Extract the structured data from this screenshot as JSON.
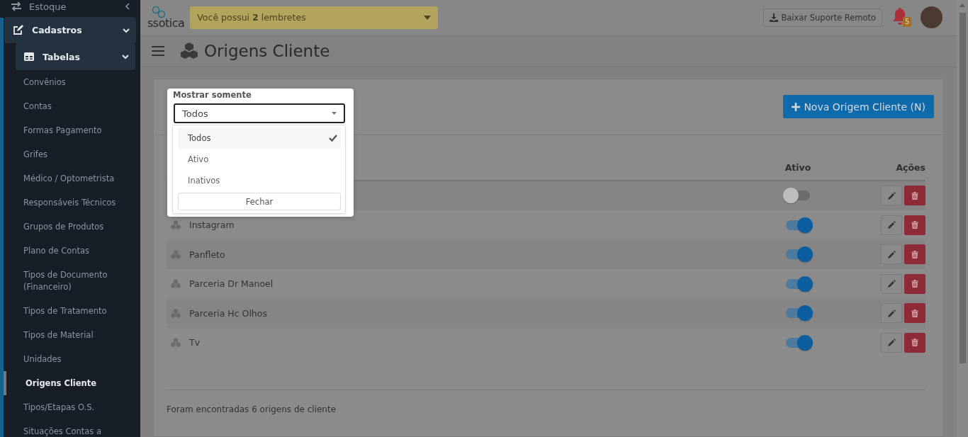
{
  "sidebar": {
    "sections": [
      {
        "label": "Estoque",
        "expanded": false
      },
      {
        "label": "Cadastros",
        "expanded": true,
        "children": [
          {
            "label": "Tabelas",
            "expanded": true,
            "children": [
              {
                "label": "Convênios",
                "selected": false
              },
              {
                "label": "Contas",
                "selected": false
              },
              {
                "label": "Formas Pagamento",
                "selected": false
              },
              {
                "label": "Grifes",
                "selected": false
              },
              {
                "label": "Médico / Optometrista",
                "selected": false
              },
              {
                "label": "Responsáveis Técnicos",
                "selected": false
              },
              {
                "label": "Grupos de Produtos",
                "selected": false
              },
              {
                "label": "Plano de Contas",
                "selected": false
              },
              {
                "label": "Tipos de Documento (Financeiro)",
                "selected": false
              },
              {
                "label": "Tipos de Tratamento",
                "selected": false
              },
              {
                "label": "Tipos de Material",
                "selected": false
              },
              {
                "label": "Unidades",
                "selected": false
              },
              {
                "label": "Origens Cliente",
                "selected": true
              },
              {
                "label": "Tipos/Etapas O.S.",
                "selected": false
              },
              {
                "label": "Situações Contas a",
                "selected": false
              }
            ]
          }
        ]
      }
    ]
  },
  "topbar": {
    "logo": "ssotica",
    "reminder": "Você possui **2** lembretes",
    "support_button": "Baixar Suporte Remoto",
    "notification_count": "5"
  },
  "page": {
    "title": "Origens Cliente",
    "new_button": "Nova Origem Cliente (N)"
  },
  "table": {
    "columns": [
      "Ativo",
      "Ações"
    ],
    "rows": [
      {
        "active": false
      },
      {
        "name": "Instagram",
        "active": true
      },
      {
        "name": "Panfleto",
        "active": true
      },
      {
        "name": "Parceria Dr Manoel",
        "active": true
      },
      {
        "name": "Parceria Hc Olhos",
        "active": true
      },
      {
        "name": "Tv",
        "active": true
      }
    ],
    "footer": "Foram encontradas 6 origens de cliente"
  },
  "filter_popup": {
    "label": "Mostrar somente",
    "value": "Todos",
    "options": [
      {
        "label": "Todos",
        "selected": true
      },
      {
        "label": "Ativo",
        "selected": false
      },
      {
        "label": "Inativos",
        "selected": false
      }
    ],
    "close_button": "Fechar"
  }
}
